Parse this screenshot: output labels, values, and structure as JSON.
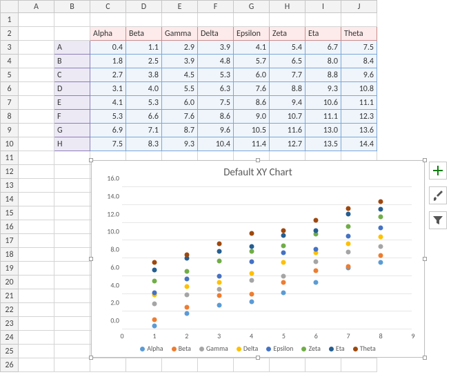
{
  "col_letters": [
    "A",
    "B",
    "C",
    "D",
    "E",
    "F",
    "G",
    "H",
    "I",
    "J"
  ],
  "row_nums": [
    1,
    2,
    3,
    4,
    5,
    6,
    7,
    8,
    9,
    10,
    11,
    12,
    13,
    14,
    15,
    16,
    17,
    18,
    19,
    20,
    21,
    22,
    23,
    24,
    25,
    26
  ],
  "col_headers": [
    "Alpha",
    "Beta",
    "Gamma",
    "Delta",
    "Epsilon",
    "Zeta",
    "Eta",
    "Theta"
  ],
  "row_headers": [
    "A",
    "B",
    "C",
    "D",
    "E",
    "F",
    "G",
    "H"
  ],
  "table": [
    [
      0.4,
      1.1,
      2.9,
      3.9,
      4.1,
      5.4,
      6.7,
      7.5
    ],
    [
      1.8,
      2.5,
      3.9,
      4.8,
      5.7,
      6.5,
      8.0,
      8.4
    ],
    [
      2.7,
      3.8,
      4.5,
      5.3,
      6.0,
      7.7,
      8.8,
      9.6
    ],
    [
      3.1,
      4.0,
      5.5,
      6.3,
      7.6,
      8.8,
      9.3,
      10.8
    ],
    [
      4.1,
      5.3,
      6.0,
      7.5,
      8.6,
      9.4,
      10.6,
      11.1
    ],
    [
      5.3,
      6.6,
      7.6,
      8.6,
      9.0,
      10.7,
      11.1,
      12.3
    ],
    [
      6.9,
      7.1,
      8.7,
      9.6,
      10.5,
      11.6,
      13.0,
      13.6
    ],
    [
      7.5,
      8.3,
      9.3,
      10.4,
      11.4,
      12.7,
      13.5,
      14.4
    ]
  ],
  "chart_data": {
    "type": "scatter",
    "title": "Default XY Chart",
    "xlabel": "",
    "ylabel": "",
    "x": [
      1,
      2,
      3,
      4,
      5,
      6,
      7,
      8
    ],
    "xlim": [
      0,
      9
    ],
    "ylim": [
      0,
      16
    ],
    "xticks": [
      0,
      1,
      2,
      3,
      4,
      5,
      6,
      7,
      8,
      9
    ],
    "yticks": [
      0.0,
      2.0,
      4.0,
      6.0,
      8.0,
      10.0,
      12.0,
      14.0,
      16.0
    ],
    "series": [
      {
        "name": "Alpha",
        "color": "#5B9BD5",
        "values": [
          0.4,
          1.8,
          2.7,
          3.1,
          4.1,
          5.3,
          6.9,
          7.5
        ]
      },
      {
        "name": "Beta",
        "color": "#ED7D31",
        "values": [
          1.1,
          2.5,
          3.8,
          4.0,
          5.3,
          6.6,
          7.1,
          8.3
        ]
      },
      {
        "name": "Gamma",
        "color": "#A5A5A5",
        "values": [
          2.9,
          3.9,
          4.5,
          5.5,
          6.0,
          7.6,
          8.7,
          9.3
        ]
      },
      {
        "name": "Delta",
        "color": "#FFC000",
        "values": [
          3.9,
          4.8,
          5.3,
          6.3,
          7.5,
          8.6,
          9.6,
          10.4
        ]
      },
      {
        "name": "Epsilon",
        "color": "#4472C4",
        "values": [
          4.1,
          5.7,
          6.0,
          7.6,
          8.6,
          9.0,
          10.5,
          11.4
        ]
      },
      {
        "name": "Zeta",
        "color": "#70AD47",
        "values": [
          5.4,
          6.5,
          7.7,
          8.8,
          9.4,
          10.7,
          11.6,
          12.7
        ]
      },
      {
        "name": "Eta",
        "color": "#255E91",
        "values": [
          6.7,
          8.0,
          8.8,
          9.3,
          10.6,
          11.1,
          13.0,
          13.5
        ]
      },
      {
        "name": "Theta",
        "color": "#9E480E",
        "values": [
          7.5,
          8.4,
          9.6,
          10.8,
          11.1,
          12.3,
          13.6,
          14.4
        ]
      }
    ]
  },
  "side_buttons": {
    "add": "+",
    "style": "brush",
    "filter": "filter"
  }
}
